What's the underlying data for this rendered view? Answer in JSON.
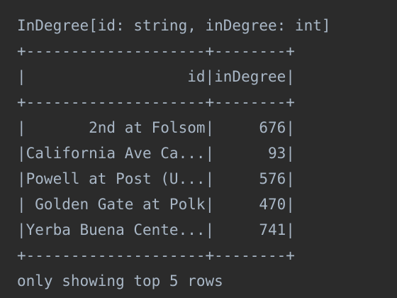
{
  "console": {
    "schema_line": "InDegree[id: string, inDegree: int]",
    "border_top": "+--------------------+--------+",
    "header_row": "|                  id|inDegree|",
    "border_header": "+--------------------+--------+",
    "rows": [
      "|       2nd at Folsom|     676|",
      "|California Ave Ca...|      93|",
      "|Powell at Post (U...|     576|",
      "| Golden Gate at Polk|     470|",
      "|Yerba Buena Cente...|     741|"
    ],
    "border_bottom": "+--------------------+--------+",
    "footer": "only showing top 5 rows"
  }
}
